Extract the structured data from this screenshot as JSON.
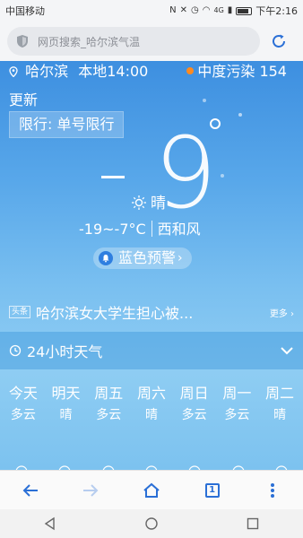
{
  "status_bar": {
    "carrier": "中国移动",
    "time": "下午2:16",
    "network": "4G"
  },
  "search": {
    "placeholder": "网页搜索_哈尔滨气温"
  },
  "weather": {
    "city": "哈尔滨",
    "local_time": "本地14:00",
    "pollution": "中度污染 154",
    "update_label": "更新",
    "restriction": "限行: 单号限行",
    "temperature": "9",
    "condition": "晴",
    "temp_range": "-19~-7°C",
    "wind": "西和风",
    "alert": "蓝色预警"
  },
  "news": {
    "tag": "头条",
    "title": "哈尔滨女大学生担心被...",
    "more": "更多"
  },
  "hourly": {
    "title": "24小时天气"
  },
  "forecast": [
    {
      "day": "今天",
      "cond": "多云"
    },
    {
      "day": "明天",
      "cond": "晴"
    },
    {
      "day": "周五",
      "cond": "多云"
    },
    {
      "day": "周六",
      "cond": "晴"
    },
    {
      "day": "周日",
      "cond": "多云"
    },
    {
      "day": "周一",
      "cond": "多云"
    },
    {
      "day": "周二",
      "cond": "晴"
    }
  ],
  "toolbar": {
    "tab_count": "1"
  },
  "colors": {
    "accent": "#2a6fd6",
    "pollution_dot": "#ff8a1f",
    "sky_top": "#3d8fe0",
    "sky_bottom": "#8fcdf3"
  }
}
